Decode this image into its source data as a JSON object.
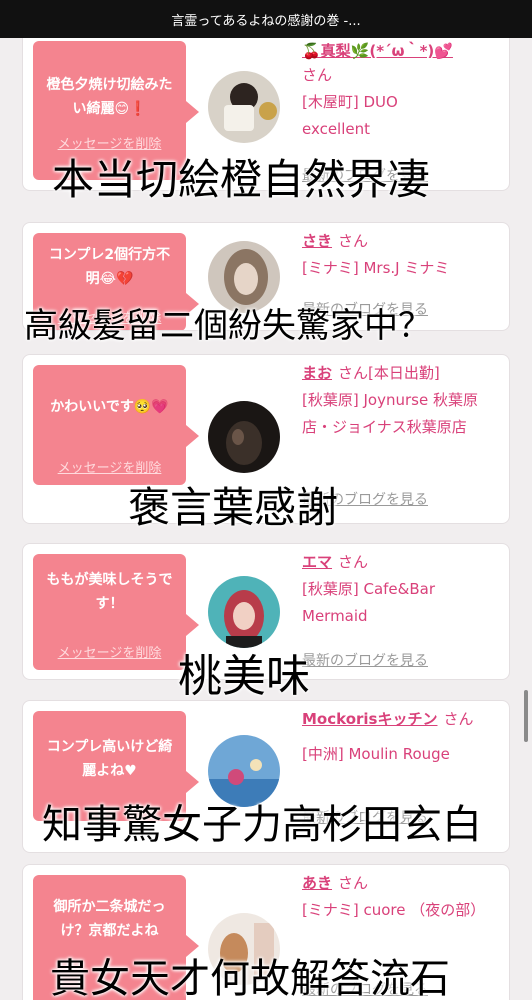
{
  "header": {
    "title": "言霊ってあるよねの感謝の巻 -..."
  },
  "cards": [
    {
      "message": "橙色夕焼け切絵みたい綺麗😊❗",
      "delete_label": "メッセージを削除",
      "name": "🍒真梨🌿(*´ω｀*)💕",
      "honorific": "さん",
      "shop": "[木屋町] DUO excellent",
      "blog_label": "最新のブログを見る"
    },
    {
      "message": "コンプレ2個行方不明😂💔",
      "delete_label": "メッセージを削除",
      "name": "さき",
      "honorific": "さん",
      "shop": "[ミナミ] Mrs.J ミナミ",
      "blog_label": "最新のブログを見る"
    },
    {
      "message": "かわいいです🥺💗",
      "delete_label": "メッセージを削除",
      "name": "まお",
      "honorific": "さん[本日出勤]",
      "shop": "[秋葉原] Joynurse 秋葉原店・ジョイナス秋葉原店",
      "blog_label": "最新のブログを見る"
    },
    {
      "message": "ももが美味しそうです！",
      "delete_label": "メッセージを削除",
      "name": "エマ",
      "honorific": "さん",
      "shop": "[秋葉原] Cafe&Bar Mermaid",
      "blog_label": "最新のブログを見る"
    },
    {
      "message": "コンプレ高いけど綺麗よね♥",
      "delete_label": "メッセージを削除",
      "name": "Mockorisキッチン",
      "honorific": "さん",
      "shop": "[中洲] Moulin Rouge",
      "blog_label": "最新のブログを見る"
    },
    {
      "message": "御所か二条城だっけ？京都だよね",
      "delete_label": "メッセージを削除",
      "name": "あき",
      "honorific": "さん",
      "shop": "[ミナミ] cuore （夜の部）",
      "blog_label": "最新のブログを見る"
    }
  ],
  "overlays": [
    "本当切絵橙自然界凄",
    "高級髪留二個紛失驚家中？",
    "褒言葉感謝",
    "桃美味",
    "知事驚女子力高杉田玄白",
    "貴女天才何故解答流石"
  ],
  "colors": {
    "bubble": "#f4848f",
    "accent": "#d9417a",
    "header_bg": "#111111",
    "page_bg": "#f1eeef"
  }
}
